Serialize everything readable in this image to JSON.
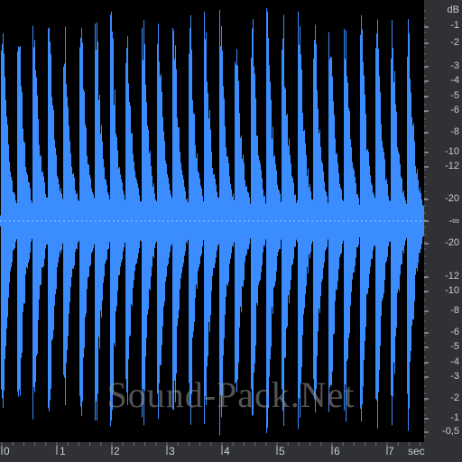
{
  "waveform": {
    "color": "#3a8cff",
    "background": "#000000",
    "center_line_color": "#9fc8ff",
    "beat_count": 27,
    "duration_sec": 7.65
  },
  "db_scale": {
    "unit_label": "dB",
    "labels": [
      "-1",
      "-2",
      "-3",
      "-4",
      "-5",
      "-6",
      "-8",
      "-10",
      "-12",
      "-20",
      "-∞",
      "-20",
      "-12",
      "-10",
      "-8",
      "-6",
      "-5",
      "-4",
      "-3",
      "-2",
      "-1",
      "-0,5"
    ]
  },
  "time_scale": {
    "unit_label": "sec",
    "labels": [
      "0",
      "1",
      "2",
      "3",
      "4",
      "5",
      "6",
      "7"
    ]
  },
  "watermark": {
    "text": "Sound-Pack.Net"
  },
  "colors": {
    "ruler_background": "#2f3135",
    "ruler_text": "#c9ccd1"
  }
}
